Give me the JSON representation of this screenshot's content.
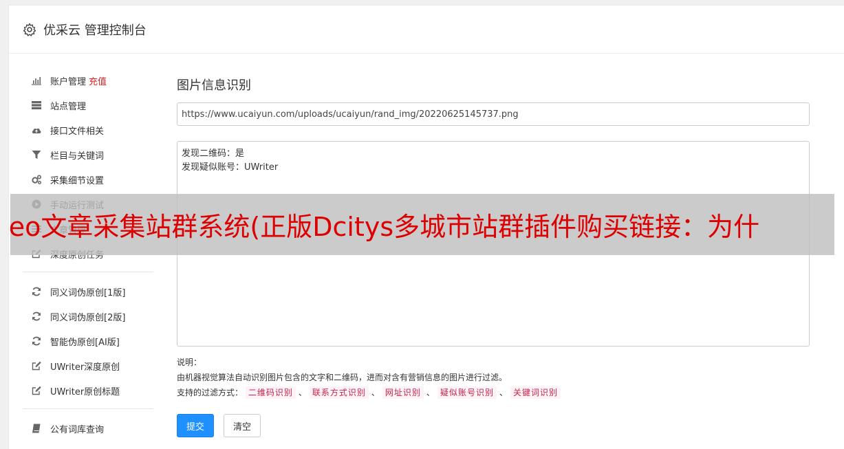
{
  "header": {
    "title": "优采云 管理控制台"
  },
  "sidebar": {
    "items_group1": [
      {
        "label": "账户管理",
        "icon": "bar-chart-icon",
        "extra": "充值"
      },
      {
        "label": "站点管理",
        "icon": "server-icon"
      },
      {
        "label": "接口文件相关",
        "icon": "cloud-upload-icon"
      },
      {
        "label": "栏目与关键词",
        "icon": "filter-icon"
      },
      {
        "label": "采集细节设置",
        "icon": "gears-icon"
      },
      {
        "label": "手动运行测试",
        "icon": "play-circle-icon"
      },
      {
        "label": "文章管理",
        "icon": "list-icon"
      },
      {
        "label": "深度原创任务",
        "icon": "edit-icon"
      }
    ],
    "items_group2": [
      {
        "label": "同义词伪原创[1版]",
        "icon": "refresh-icon"
      },
      {
        "label": "同义词伪原创[2版]",
        "icon": "refresh-icon"
      },
      {
        "label": "智能伪原创[AI版]",
        "icon": "refresh-icon"
      },
      {
        "label": "UWriter深度原创",
        "icon": "edit-icon"
      },
      {
        "label": "UWriter原创标题",
        "icon": "edit-icon"
      }
    ],
    "items_group3": [
      {
        "label": "公有词库查询",
        "icon": "book-icon"
      }
    ]
  },
  "main": {
    "section_title": "图片信息识别",
    "url_value": "https://www.ucaiyun.com/uploads/ucaiyun/rand_img/20220625145737.png",
    "result_lines": [
      "发现二维码：是",
      "发现疑似账号：UWriter"
    ],
    "notes_heading": "说明：",
    "notes_desc": "由机器视觉算法自动识别图片包含的文字和二维码，进而对含有营销信息的图片进行过滤。",
    "filter_label": "支持的过滤方式：",
    "filter_tags": [
      "二维码识别",
      "联系方式识别",
      "网址识别",
      "疑似账号识别",
      "关键词识别"
    ],
    "filter_sep": "、",
    "submit_label": "提交",
    "clear_label": "清空"
  },
  "overlay": {
    "text": "seo文章采集站群系统(正版Dcitys多城市站群插件购买链接：为什"
  },
  "colors": {
    "primary_button": "#1e90ff",
    "recharge_red": "#e02020",
    "tag_text": "#c7254e",
    "tag_bg": "#fdf2f5",
    "overlay_text": "#dd0000"
  }
}
